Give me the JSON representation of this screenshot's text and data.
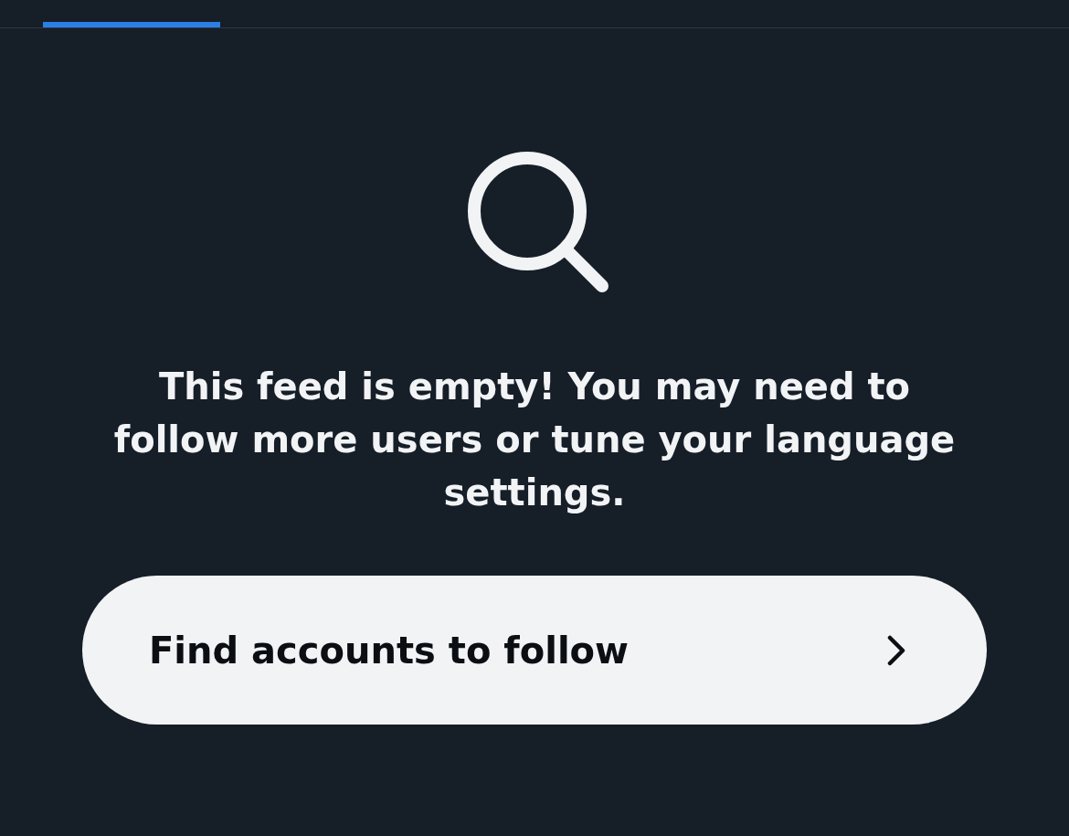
{
  "tabs": [
    {
      "selected": true
    }
  ],
  "empty_state": {
    "message": "This feed is empty! You may need to follow more users or tune your language settings.",
    "button": {
      "label": "Find accounts to follow"
    }
  }
}
